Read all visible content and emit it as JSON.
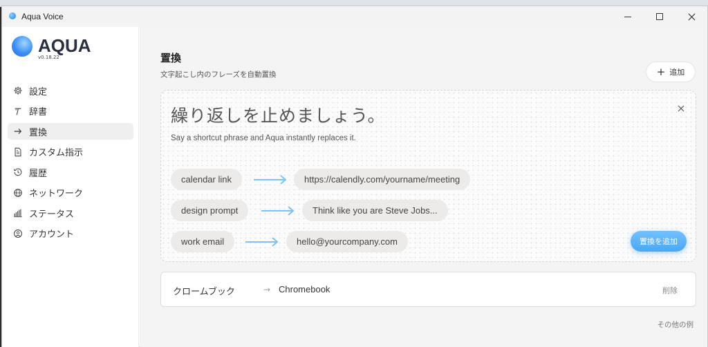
{
  "window": {
    "app_title": "Aqua Voice"
  },
  "sidebar": {
    "brand": "AQUA",
    "version": "v0.18.22",
    "items": [
      {
        "label": "設定",
        "icon": "gear-icon",
        "active": false
      },
      {
        "label": "辞書",
        "icon": "dictionary-icon",
        "active": false
      },
      {
        "label": "置換",
        "icon": "arrow-right-icon",
        "active": true
      },
      {
        "label": "カスタム指示",
        "icon": "document-icon",
        "active": false
      },
      {
        "label": "履歴",
        "icon": "history-icon",
        "active": false
      },
      {
        "label": "ネットワーク",
        "icon": "globe-icon",
        "active": false
      },
      {
        "label": "ステータス",
        "icon": "bar-chart-icon",
        "active": false
      },
      {
        "label": "アカウント",
        "icon": "user-circle-icon",
        "active": false
      }
    ]
  },
  "main": {
    "title": "置換",
    "subtitle": "文字起こし内のフレーズを自動置換",
    "add_button": "追加",
    "hero": {
      "title": "繰り返しを止めましょう。",
      "subtitle": "Say a shortcut phrase and Aqua instantly replaces it.",
      "examples": [
        {
          "from": "calendar link",
          "to": "https://calendly.com/yourname/meeting"
        },
        {
          "from": "design prompt",
          "to": "Think like you are Steve Jobs..."
        },
        {
          "from": "work email",
          "to": "hello@yourcompany.com"
        }
      ],
      "cta": "置換を追加"
    },
    "replacement": {
      "from": "クロームブック",
      "to": "Chromebook",
      "delete": "削除"
    },
    "more_examples": "その他の例"
  },
  "colors": {
    "accent": "#4aa7f5",
    "arrow": "#7cc4f5"
  }
}
